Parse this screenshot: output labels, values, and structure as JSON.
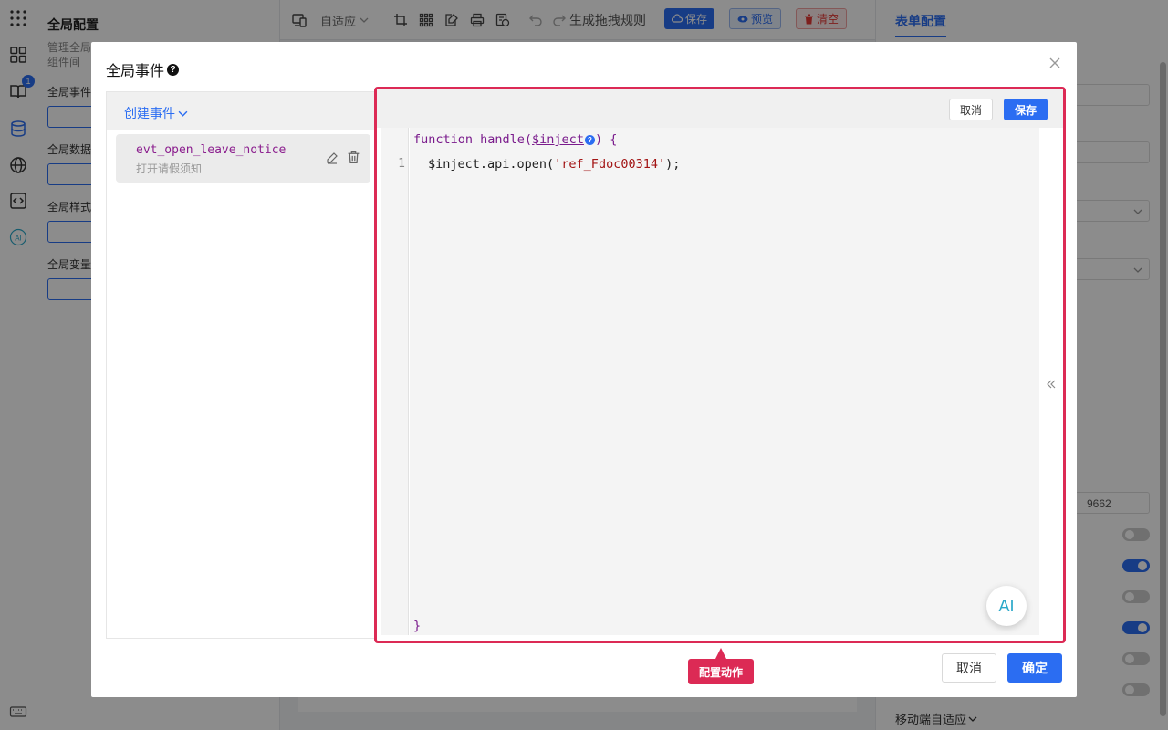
{
  "left_panel": {
    "title": "全局配置",
    "description": "管理全局同组件间",
    "sections": [
      "全局事件",
      "全局数据",
      "全局样式",
      "全局变量"
    ]
  },
  "rail": {
    "badge": "1",
    "ai_label": "AI"
  },
  "toolbar": {
    "adapt": "自适应",
    "rule": "生成拖拽规则",
    "save": "保存",
    "preview": "预览",
    "clear": "清空"
  },
  "right_panel": {
    "tab": "表单配置",
    "field_value": "9662",
    "mobile": "移动端自适应"
  },
  "modal": {
    "title": "全局事件",
    "create_label": "创建事件",
    "event": {
      "name": "evt_open_leave_notice",
      "desc": "打开请假须知"
    },
    "editor": {
      "cancel": "取消",
      "save": "保存",
      "line_number": "1",
      "code_fn": "function handle(",
      "code_param": "$inject",
      "code_close": ") {",
      "code_body_pre": "$inject.api.open(",
      "code_body_str": "'ref_Fdoc00314'",
      "code_body_post": ");",
      "code_end": "}",
      "ai": "AI"
    },
    "tooltip": "配置动作",
    "footer": {
      "cancel": "取消",
      "ok": "确定"
    }
  },
  "colors": {
    "accent": "#2b6df2",
    "highlight": "#dc2a55"
  }
}
